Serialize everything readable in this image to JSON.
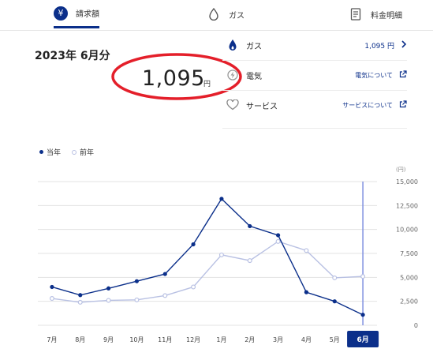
{
  "tabs": [
    {
      "label": "請求額",
      "icon": "yen-icon",
      "active": true
    },
    {
      "label": "ガス",
      "icon": "water-drop-icon",
      "active": false
    },
    {
      "label": "料金明細",
      "icon": "receipt-icon",
      "active": false
    }
  ],
  "summary": {
    "month_label": "2023年 6月分",
    "amount": "1,095",
    "unit": "円",
    "highlight_color": "#e41f2a"
  },
  "breakdown": [
    {
      "label": "ガス",
      "value": "1,095 円",
      "icon": "gas-drop-icon",
      "action_icon": "chevron-right-icon"
    },
    {
      "label": "電気",
      "value": "電気について",
      "icon": "electricity-icon",
      "action_icon": "external-link-icon"
    },
    {
      "label": "サービス",
      "value": "サービスについて",
      "icon": "heart-icon",
      "action_icon": "external-link-icon"
    }
  ],
  "legend": {
    "current": "当年",
    "previous": "前年"
  },
  "colors": {
    "current": "#0b2f8a",
    "previous": "#b9c1e3",
    "accent": "#0b2f8a"
  },
  "chart_data": {
    "type": "line",
    "x": [
      "7月",
      "8月",
      "9月",
      "10月",
      "11月",
      "12月",
      "1月",
      "2月",
      "3月",
      "4月",
      "5月",
      "6月"
    ],
    "series": [
      {
        "name": "当年",
        "values": [
          4000,
          3150,
          3850,
          4600,
          5350,
          8450,
          13200,
          10350,
          9400,
          3450,
          2500,
          1095
        ]
      },
      {
        "name": "前年",
        "values": [
          2800,
          2400,
          2600,
          2650,
          3100,
          4000,
          7350,
          6750,
          8750,
          7800,
          4950,
          5100
        ]
      }
    ],
    "unit_label": "(円)",
    "ylim": [
      0,
      15000
    ],
    "yticks": [
      "0",
      "2,500",
      "5,000",
      "7,500",
      "10,000",
      "12,500",
      "15,000"
    ],
    "selected": "6月",
    "grid": true
  }
}
